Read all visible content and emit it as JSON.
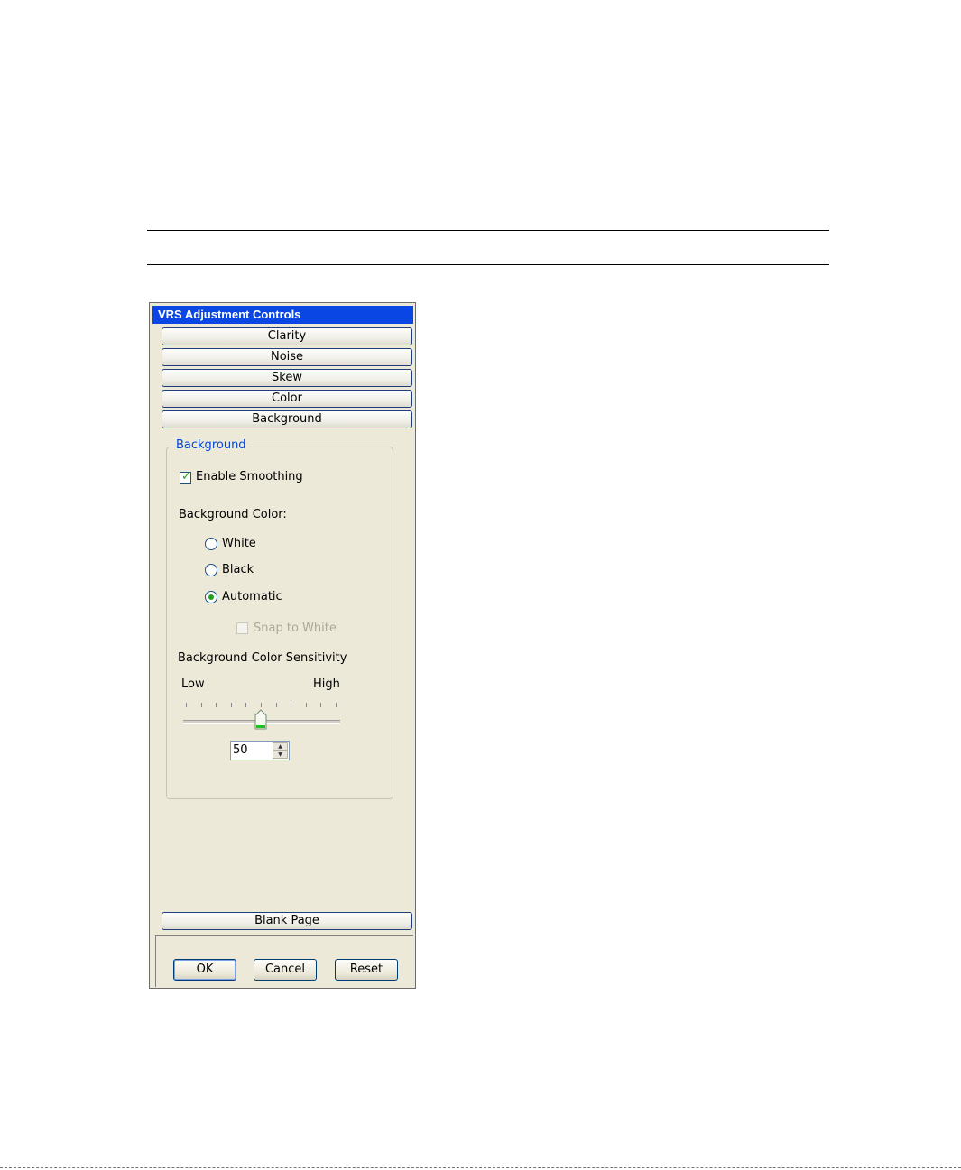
{
  "panel": {
    "title": "VRS Adjustment Controls",
    "sections": [
      "Clarity",
      "Noise",
      "Skew",
      "Color",
      "Background"
    ],
    "bottom_section": "Blank Page"
  },
  "background_group": {
    "legend": "Background",
    "enable_smoothing": {
      "label": "Enable Smoothing",
      "checked": true
    },
    "background_color_label": "Background Color:",
    "color_options": [
      {
        "label": "White",
        "selected": false
      },
      {
        "label": "Black",
        "selected": false
      },
      {
        "label": "Automatic",
        "selected": true
      }
    ],
    "snap_to_white": {
      "label": "Snap to White",
      "checked": false,
      "enabled": false
    },
    "sensitivity_label": "Background Color Sensitivity",
    "slider": {
      "low_label": "Low",
      "high_label": "High",
      "value": 50,
      "min": 0,
      "max": 100
    },
    "spin_value": "50"
  },
  "buttons": {
    "ok": "OK",
    "cancel": "Cancel",
    "reset": "Reset"
  },
  "colors": {
    "title_bar": "#0a46e4",
    "panel_bg": "#ece9d8",
    "accent_text": "#0046d5",
    "check_green": "#21a121"
  }
}
